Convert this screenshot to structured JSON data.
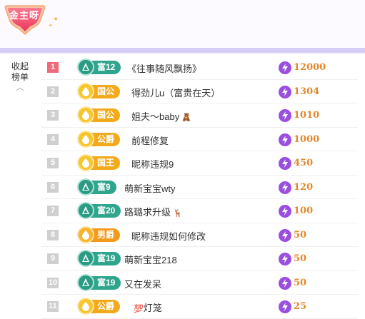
{
  "header": {
    "badge_label": "金主呀",
    "colors": {
      "badge": "#f05a7a",
      "bar": "#d6cdf4"
    }
  },
  "side": {
    "line1": "收起",
    "line2": "榜单",
    "caret": "︿"
  },
  "rows": [
    {
      "rank": "1",
      "badge_style": "teal",
      "badge": "富12",
      "name": "《往事随风飘扬》",
      "amount": "12000"
    },
    {
      "rank": "2",
      "badge_style": "gold",
      "badge": "国公",
      "name": "得劲儿u（富贵在天）",
      "amount": "1304"
    },
    {
      "rank": "3",
      "badge_style": "gold",
      "badge": "国公",
      "name": "姐夫～baby",
      "amount": "1010"
    },
    {
      "rank": "4",
      "badge_style": "gold",
      "badge": "公爵",
      "name": "前程修复",
      "amount": "1000"
    },
    {
      "rank": "5",
      "badge_style": "gold",
      "badge": "国王",
      "name": "昵称违规9",
      "amount": "450"
    },
    {
      "rank": "6",
      "badge_style": "teal",
      "badge": "富9",
      "name": "萌新宝宝wty",
      "amount": "120"
    },
    {
      "rank": "7",
      "badge_style": "teal",
      "badge": "富20",
      "name": "路璐求升级",
      "amount": "100"
    },
    {
      "rank": "8",
      "badge_style": "orange",
      "badge": "男爵",
      "name": "昵称违规如何修改",
      "amount": "50"
    },
    {
      "rank": "9",
      "badge_style": "teal",
      "badge": "富19",
      "name": "萌新宝宝218",
      "amount": "50"
    },
    {
      "rank": "10",
      "badge_style": "teal",
      "badge": "富19",
      "name": "又在发呆",
      "amount": "50"
    },
    {
      "rank": "11",
      "badge_style": "gold",
      "badge": "公爵",
      "name": "灯笼",
      "amount": "25"
    }
  ]
}
